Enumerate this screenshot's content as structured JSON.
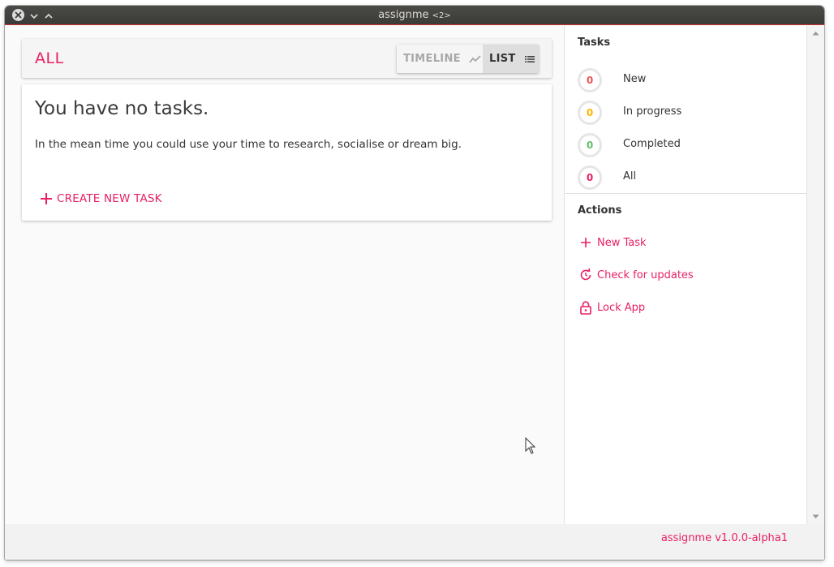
{
  "window": {
    "title": "assignme",
    "title_suffix": "<2>"
  },
  "header": {
    "filter_title": "ALL",
    "view_toggle": {
      "timeline_label": "TIMELINE",
      "list_label": "LIST",
      "active": "LIST"
    }
  },
  "empty_state": {
    "title": "You have no tasks.",
    "body": "In the mean time you could use your time to research, socialise or dream big.",
    "create_label": "CREATE NEW TASK"
  },
  "sidebar": {
    "tasks_title": "Tasks",
    "stats": [
      {
        "count": "0",
        "label": "New",
        "color": "#ef5350"
      },
      {
        "count": "0",
        "label": "In progress",
        "color": "#ffb300"
      },
      {
        "count": "0",
        "label": "Completed",
        "color": "#66bb6a"
      },
      {
        "count": "0",
        "label": "All",
        "color": "#e91e63"
      }
    ],
    "actions_title": "Actions",
    "actions": [
      {
        "label": "New Task",
        "icon": "plus-icon"
      },
      {
        "label": "Check for updates",
        "icon": "refresh-icon"
      },
      {
        "label": "Lock App",
        "icon": "lock-icon"
      }
    ]
  },
  "footer": {
    "version": "assignme v1.0.0-alpha1"
  },
  "colors": {
    "accent": "#e91e63",
    "titlebar": "#3c3b37"
  }
}
